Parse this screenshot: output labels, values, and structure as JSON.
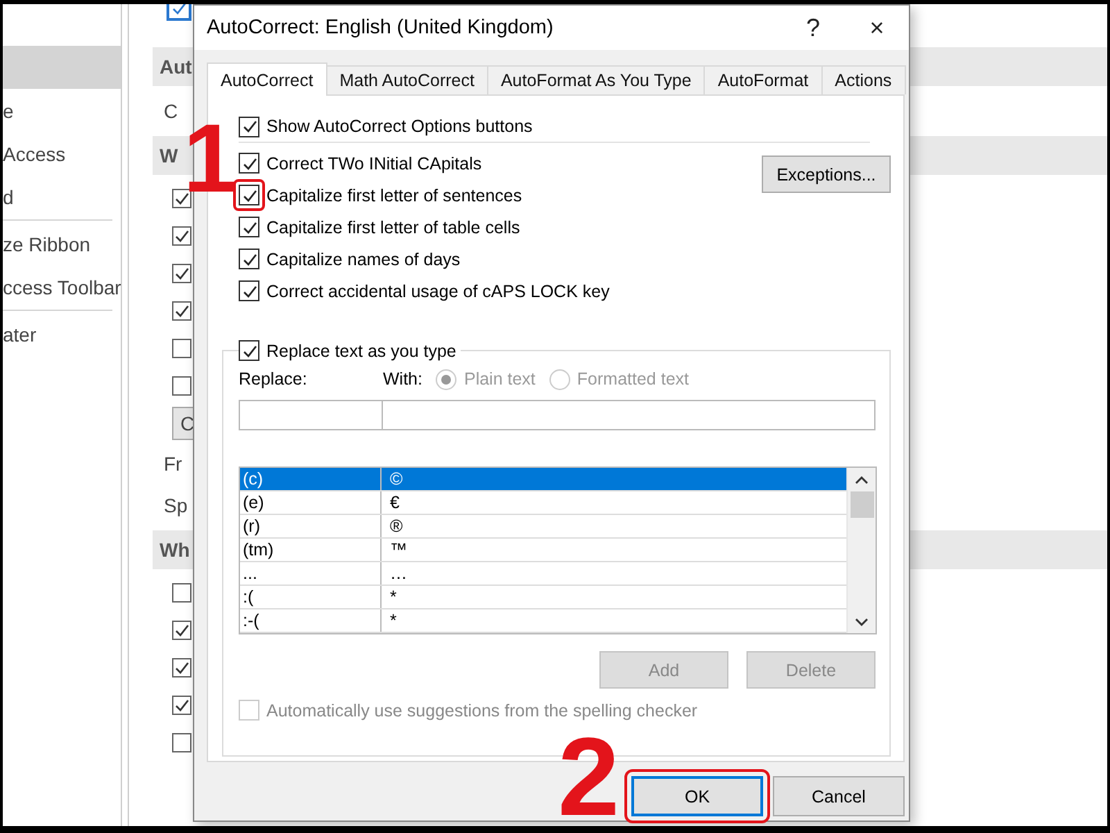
{
  "background": {
    "sidebar": [
      {
        "kind": "item",
        "selected": true
      },
      {
        "kind": "item",
        "label": "e",
        "selected": false
      },
      {
        "kind": "item",
        "label": "Access",
        "selected": false
      },
      {
        "kind": "item",
        "label": "d",
        "selected": false
      },
      {
        "kind": "divider"
      },
      {
        "kind": "item",
        "label": "ze Ribbon",
        "selected": false
      },
      {
        "kind": "item",
        "label": "ccess Toolbar",
        "selected": false
      },
      {
        "kind": "divider"
      },
      {
        "kind": "item",
        "label": "ater",
        "selected": false
      }
    ],
    "content": [
      {
        "kind": "top-checkbox",
        "checked": true
      },
      {
        "kind": "header",
        "label": "Aut"
      },
      {
        "kind": "text",
        "label": "C"
      },
      {
        "kind": "header",
        "label": "W"
      },
      {
        "kind": "checkbox",
        "checked": true
      },
      {
        "kind": "checkbox",
        "checked": true
      },
      {
        "kind": "checkbox",
        "checked": true
      },
      {
        "kind": "checkbox",
        "checked": true
      },
      {
        "kind": "checkbox",
        "checked": false
      },
      {
        "kind": "checkbox",
        "checked": false
      },
      {
        "kind": "button",
        "label": "C"
      },
      {
        "kind": "text",
        "label": "Fr"
      },
      {
        "kind": "text",
        "label": "Sp"
      },
      {
        "kind": "header",
        "label": "Wh"
      },
      {
        "kind": "checkbox",
        "checked": false
      },
      {
        "kind": "checkbox",
        "checked": true
      },
      {
        "kind": "checkbox",
        "checked": true
      },
      {
        "kind": "checkbox",
        "checked": true
      },
      {
        "kind": "checkbox",
        "checked": false
      }
    ]
  },
  "dialog": {
    "title": "AutoCorrect: English (United Kingdom)",
    "help": "?",
    "close": "×",
    "tabs": [
      {
        "label": "AutoCorrect",
        "selected": true
      },
      {
        "label": "Math AutoCorrect",
        "selected": false
      },
      {
        "label": "AutoFormat As You Type",
        "selected": false
      },
      {
        "label": "AutoFormat",
        "selected": false
      },
      {
        "label": "Actions",
        "selected": false
      }
    ],
    "options": [
      {
        "label": "Show AutoCorrect Options buttons",
        "checked": true,
        "highlighted": false
      },
      {
        "label": "Correct TWo INitial CApitals",
        "checked": true,
        "highlighted": false
      },
      {
        "label": "Capitalize first letter of sentences",
        "checked": true,
        "highlighted": true
      },
      {
        "label": "Capitalize first letter of table cells",
        "checked": true,
        "highlighted": false
      },
      {
        "label": "Capitalize names of days",
        "checked": true,
        "highlighted": false
      },
      {
        "label": "Correct accidental usage of cAPS LOCK key",
        "checked": true,
        "highlighted": false
      }
    ],
    "exceptions_button": "Exceptions...",
    "replace_group": {
      "label": "Replace text as you type",
      "checked": true,
      "replace_label": "Replace:",
      "with_label": "With:",
      "radios": [
        {
          "label": "Plain text",
          "selected": true,
          "disabled": true
        },
        {
          "label": "Formatted text",
          "selected": false,
          "disabled": true
        }
      ],
      "entries": [
        {
          "replace": "(c)",
          "with": "©",
          "selected": true
        },
        {
          "replace": "(e)",
          "with": "€",
          "selected": false
        },
        {
          "replace": "(r)",
          "with": "®",
          "selected": false
        },
        {
          "replace": "(tm)",
          "with": "™",
          "selected": false
        },
        {
          "replace": "...",
          "with": "…",
          "selected": false
        },
        {
          "replace": ":(",
          "with": "*",
          "selected": false
        },
        {
          "replace": ":-(",
          "with": "*",
          "selected": false
        }
      ],
      "buttons": [
        {
          "label": "Add",
          "disabled": true
        },
        {
          "label": "Delete",
          "disabled": true
        }
      ],
      "auto_suggest": {
        "label": "Automatically use suggestions from the spelling checker",
        "checked": false,
        "disabled": true
      }
    },
    "buttons": [
      {
        "label": "OK",
        "focused": true,
        "highlighted": true
      },
      {
        "label": "Cancel",
        "focused": false,
        "highlighted": false
      }
    ]
  },
  "annotations": [
    {
      "text": "1"
    },
    {
      "text": "2"
    }
  ]
}
